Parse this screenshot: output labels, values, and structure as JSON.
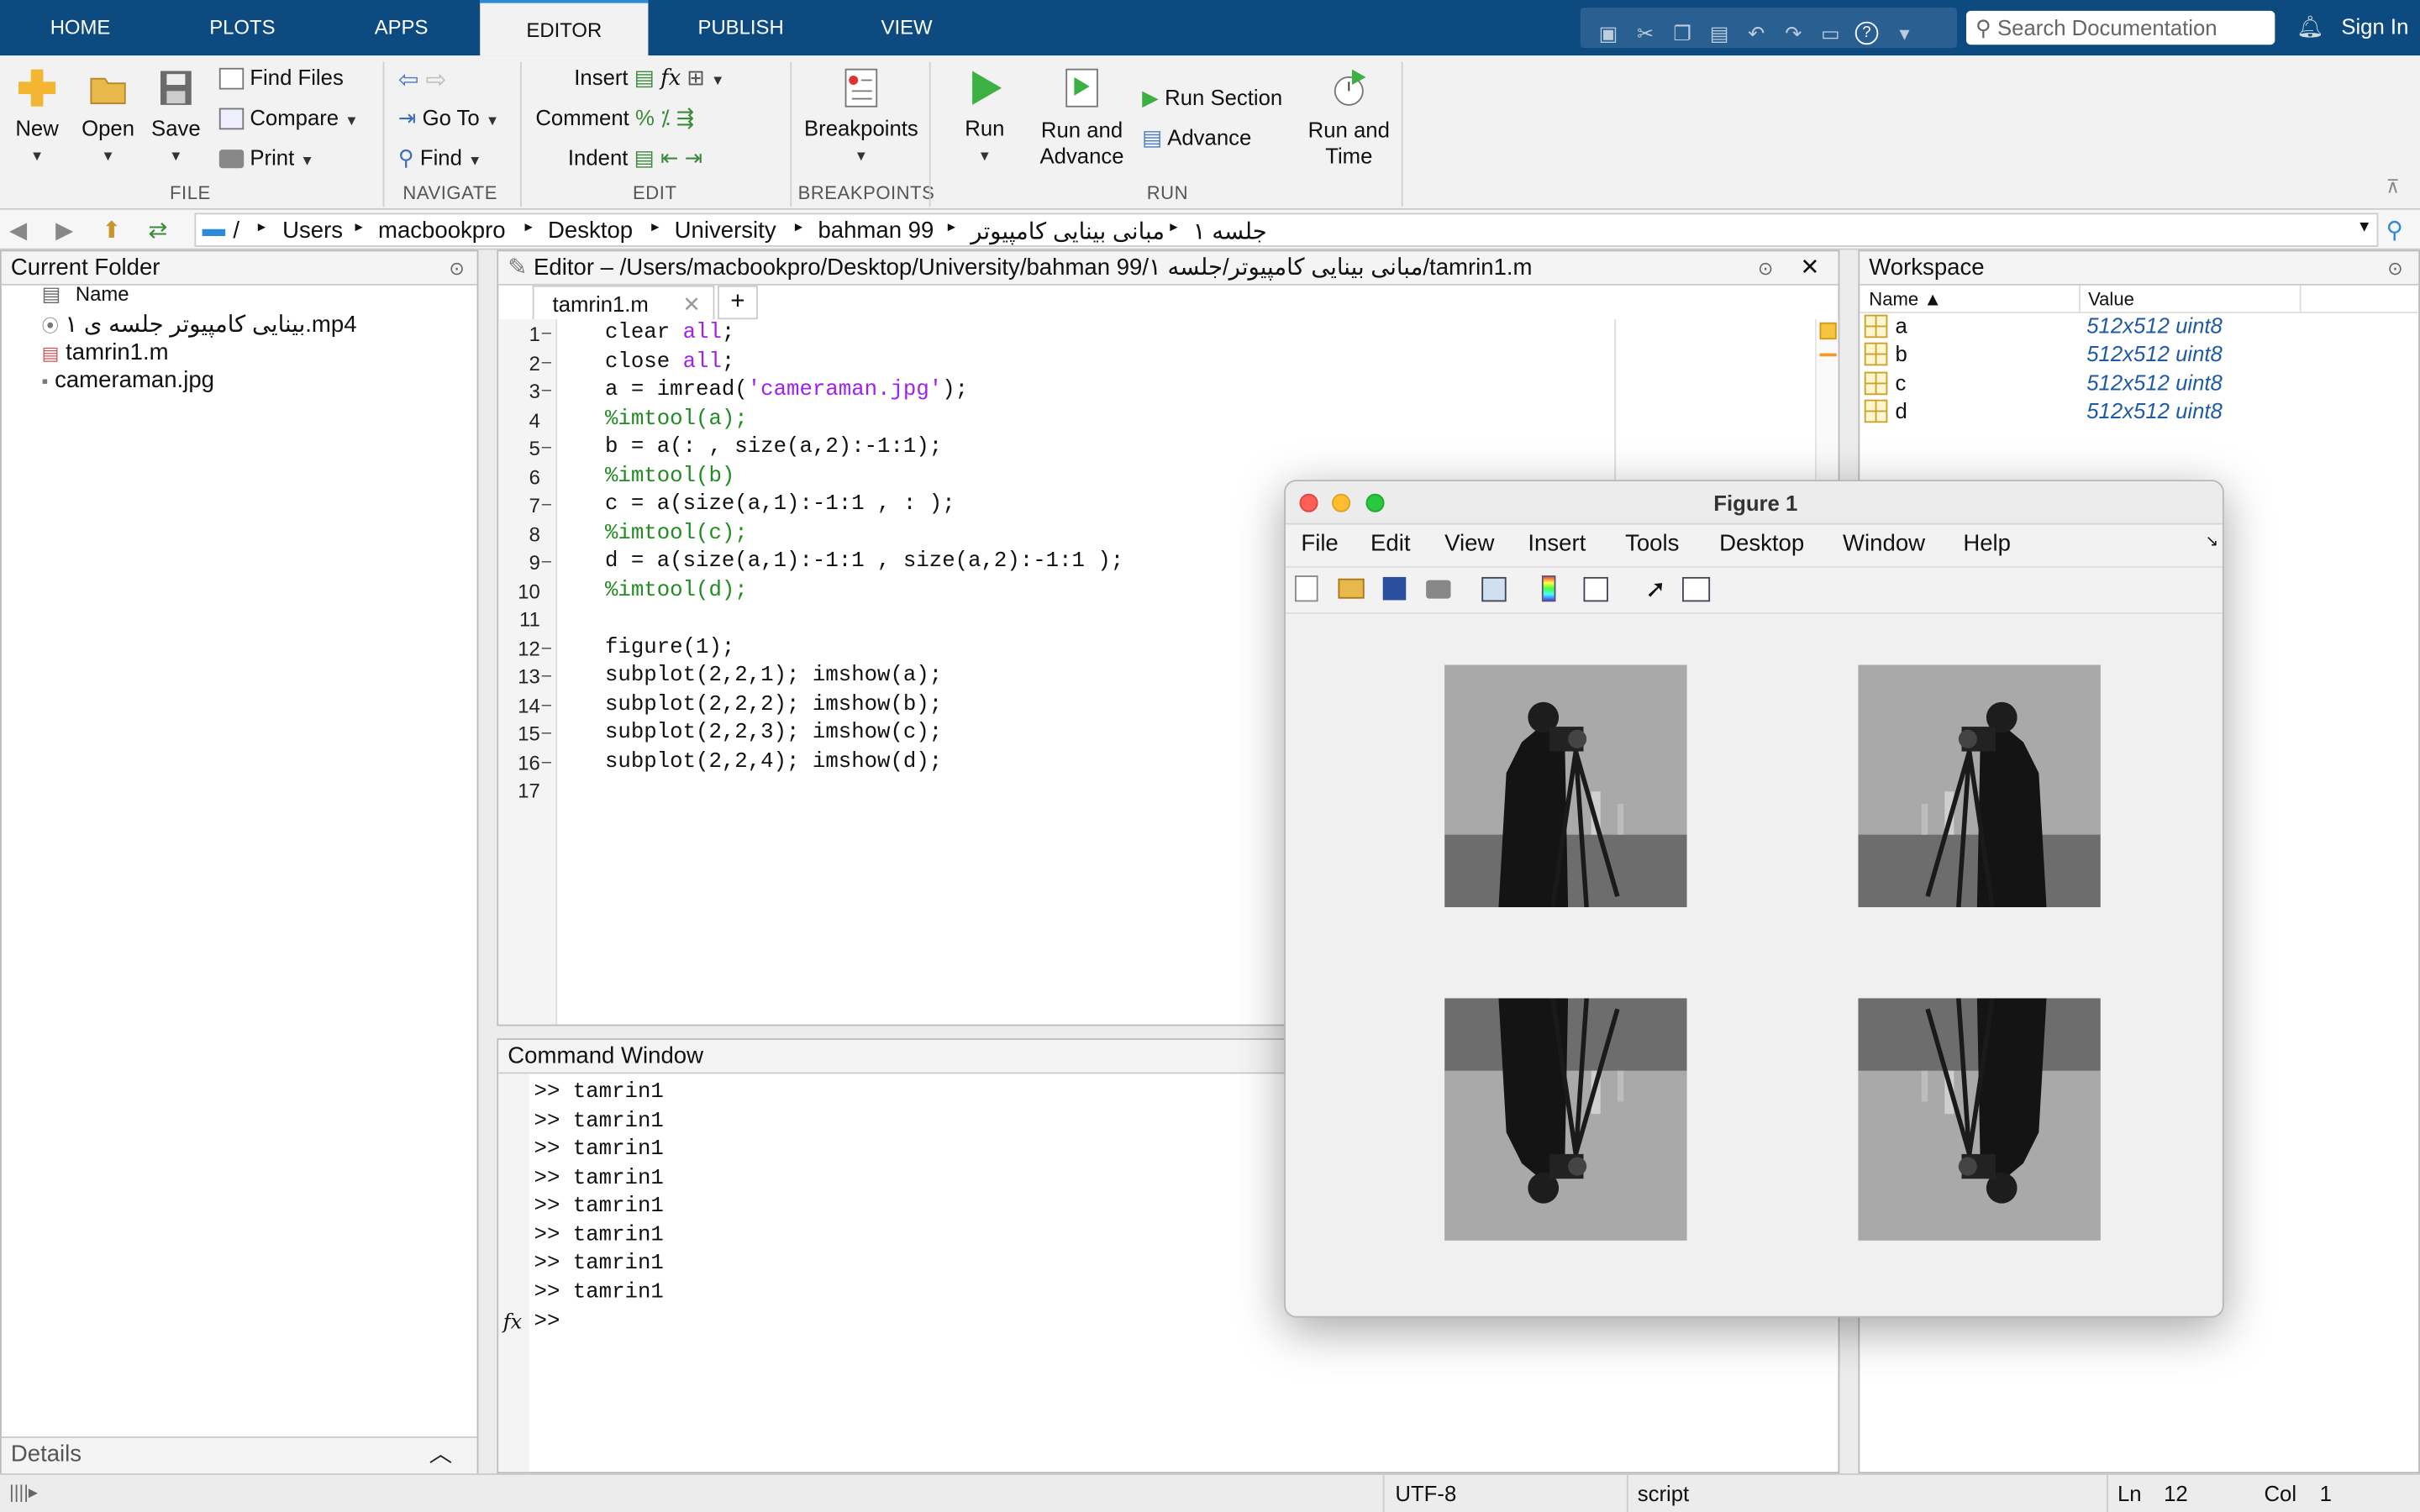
{
  "tabs": [
    "HOME",
    "PLOTS",
    "APPS",
    "EDITOR",
    "PUBLISH",
    "VIEW"
  ],
  "search": {
    "placeholder": "Search Documentation"
  },
  "signin": "Sign In",
  "ribbon": {
    "file": {
      "new": "New",
      "open": "Open",
      "save": "Save",
      "find_files": "Find Files",
      "compare": "Compare",
      "print": "Print",
      "group": "FILE"
    },
    "navigate": {
      "goto": "Go To",
      "find": "Find",
      "group": "NAVIGATE"
    },
    "edit": {
      "insert": "Insert",
      "comment": "Comment",
      "indent": "Indent",
      "group": "EDIT"
    },
    "breakpoints": {
      "label": "Breakpoints",
      "group": "BREAKPOINTS"
    },
    "run": {
      "run": "Run",
      "run_advance_1": "Run and",
      "run_advance_2": "Advance",
      "run_section": "Run Section",
      "advance": "Advance",
      "run_time_1": "Run and",
      "run_time_2": "Time",
      "group": "RUN"
    }
  },
  "path": [
    "/",
    "Users",
    "macbookpro",
    "Desktop",
    "University",
    "bahman 99",
    "مبانی بینایی کامپیوتر",
    "جلسه ۱"
  ],
  "folder": {
    "title": "Current Folder",
    "col": "Name",
    "files": [
      "بینایی کامپیوتر جلسه ی ۱.mp4",
      "tamrin1.m",
      "cameraman.jpg"
    ],
    "details": "Details"
  },
  "editor": {
    "title": "Editor – /Users/macbookpro/Desktop/University/bahman 99/مبانی بینایی کامپیوتر/جلسه ۱/tamrin1.m",
    "tab": "tamrin1.m",
    "lines": [
      "1",
      "2",
      "3",
      "4",
      "5",
      "6",
      "7",
      "8",
      "9",
      "10",
      "11",
      "12",
      "13",
      "14",
      "15",
      "16",
      "17"
    ],
    "code": {
      "l1a": "clear ",
      "l1b": "all",
      "l1c": ";",
      "l2a": "close ",
      "l2b": "all",
      "l2c": ";",
      "l3a": "a = imread(",
      "l3b": "'cameraman.jpg'",
      "l3c": ");",
      "l4": "%imtool(a);",
      "l5": "b = a(: , size(a,2):-1:1);",
      "l6": "%imtool(b)",
      "l7": "c = a(size(a,1):-1:1 , : );",
      "l8": "%imtool(c);",
      "l9": "d = a(size(a,1):-1:1 , size(a,2):-1:1 );",
      "l10": "%imtool(d);",
      "l12": "figure(1);",
      "l13": "subplot(2,2,1); imshow(a);",
      "l14": "subplot(2,2,2); imshow(b);",
      "l15": "subplot(2,2,3); imshow(c);",
      "l16": "subplot(2,2,4); imshow(d);"
    }
  },
  "command": {
    "title": "Command Window",
    "history": [
      ">> tamrin1",
      ">> tamrin1",
      ">> tamrin1",
      ">> tamrin1",
      ">> tamrin1",
      ">> tamrin1",
      ">> tamrin1",
      ">> tamrin1"
    ],
    "prompt": ">>",
    "fx": "fx"
  },
  "workspace": {
    "title": "Workspace",
    "col_name": "Name ▲",
    "col_value": "Value",
    "vars": [
      {
        "name": "a",
        "value": "512x512 uint8"
      },
      {
        "name": "b",
        "value": "512x512 uint8"
      },
      {
        "name": "c",
        "value": "512x512 uint8"
      },
      {
        "name": "d",
        "value": "512x512 uint8"
      }
    ]
  },
  "figure": {
    "title": "Figure 1",
    "menu": [
      "File",
      "Edit",
      "View",
      "Insert",
      "Tools",
      "Desktop",
      "Window",
      "Help"
    ]
  },
  "status": {
    "encoding": "UTF-8",
    "type": "script",
    "ln_label": "Ln",
    "ln": "12",
    "col_label": "Col",
    "col": "1"
  }
}
